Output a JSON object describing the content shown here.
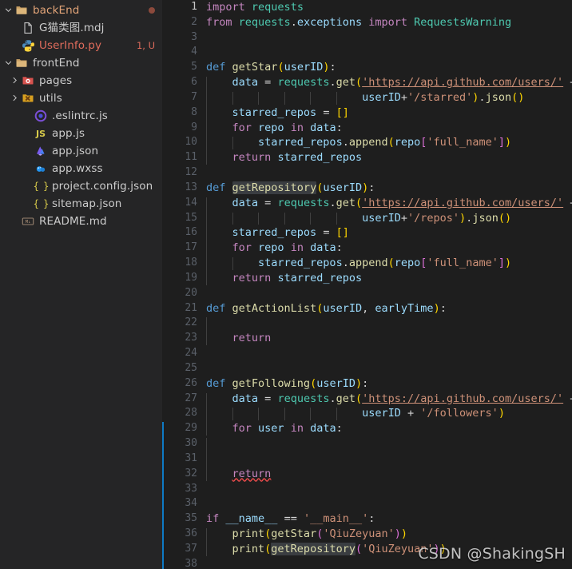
{
  "sidebar": {
    "items": [
      {
        "label": "backEnd",
        "icon": "folder-open-icon",
        "indent": 0,
        "twisty": "chevron-down",
        "state": "modified",
        "badge": "",
        "dot": true
      },
      {
        "label": "G猫类图.mdj",
        "icon": "file-icon",
        "indent": 1,
        "twisty": "",
        "state": "normal",
        "badge": "",
        "dot": false
      },
      {
        "label": "UserInfo.py",
        "icon": "python-icon",
        "indent": 1,
        "twisty": "",
        "state": "untracked",
        "badge": "1, U",
        "dot": false
      },
      {
        "label": "frontEnd",
        "icon": "folder-open-icon",
        "indent": 0,
        "twisty": "chevron-down",
        "state": "normal",
        "badge": "",
        "dot": false
      },
      {
        "label": "pages",
        "icon": "folder-pages-icon",
        "indent": 1,
        "twisty": "chevron-right",
        "state": "normal",
        "badge": "",
        "dot": false
      },
      {
        "label": "utils",
        "icon": "folder-utils-icon",
        "indent": 1,
        "twisty": "chevron-right",
        "state": "normal",
        "badge": "",
        "dot": false
      },
      {
        "label": ".eslintrc.js",
        "icon": "eslint-icon",
        "indent": 2,
        "twisty": "",
        "state": "normal",
        "badge": "",
        "dot": false
      },
      {
        "label": "app.js",
        "icon": "javascript-icon",
        "indent": 2,
        "twisty": "",
        "state": "normal",
        "badge": "",
        "dot": false
      },
      {
        "label": "app.json",
        "icon": "appjson-icon",
        "indent": 2,
        "twisty": "",
        "state": "normal",
        "badge": "",
        "dot": false
      },
      {
        "label": "app.wxss",
        "icon": "wxss-icon",
        "indent": 2,
        "twisty": "",
        "state": "normal",
        "badge": "",
        "dot": false
      },
      {
        "label": "project.config.json",
        "icon": "json-braces-icon",
        "indent": 2,
        "twisty": "",
        "state": "normal",
        "badge": "",
        "dot": false
      },
      {
        "label": "sitemap.json",
        "icon": "json-braces-icon",
        "indent": 2,
        "twisty": "",
        "state": "normal",
        "badge": "",
        "dot": false
      },
      {
        "label": "README.md",
        "icon": "markdown-icon",
        "indent": 1,
        "twisty": "",
        "state": "normal",
        "badge": "",
        "dot": false
      }
    ]
  },
  "editor": {
    "language": "python",
    "active_line": 1,
    "first_line": 1,
    "last_line": 38,
    "selected_word": "getRepository",
    "lines": [
      {
        "n": 1,
        "text": "import requests"
      },
      {
        "n": 2,
        "text": "from requests.exceptions import RequestsWarning"
      },
      {
        "n": 3,
        "text": ""
      },
      {
        "n": 4,
        "text": ""
      },
      {
        "n": 5,
        "text": "def getStar(userID):"
      },
      {
        "n": 6,
        "text": "    data = requests.get('https://api.github.com/users/' +"
      },
      {
        "n": 7,
        "text": "                        userID+'/starred').json()"
      },
      {
        "n": 8,
        "text": "    starred_repos = []"
      },
      {
        "n": 9,
        "text": "    for repo in data:"
      },
      {
        "n": 10,
        "text": "        starred_repos.append(repo['full_name'])"
      },
      {
        "n": 11,
        "text": "    return starred_repos"
      },
      {
        "n": 12,
        "text": ""
      },
      {
        "n": 13,
        "text": "def getRepository(userID):"
      },
      {
        "n": 14,
        "text": "    data = requests.get('https://api.github.com/users/' +"
      },
      {
        "n": 15,
        "text": "                        userID+'/repos').json()"
      },
      {
        "n": 16,
        "text": "    starred_repos = []"
      },
      {
        "n": 17,
        "text": "    for repo in data:"
      },
      {
        "n": 18,
        "text": "        starred_repos.append(repo['full_name'])"
      },
      {
        "n": 19,
        "text": "    return starred_repos"
      },
      {
        "n": 20,
        "text": ""
      },
      {
        "n": 21,
        "text": "def getActionList(userID, earlyTime):"
      },
      {
        "n": 22,
        "text": ""
      },
      {
        "n": 23,
        "text": "    return"
      },
      {
        "n": 24,
        "text": ""
      },
      {
        "n": 25,
        "text": ""
      },
      {
        "n": 26,
        "text": "def getFollowing(userID):"
      },
      {
        "n": 27,
        "text": "    data = requests.get('https://api.github.com/users/' +"
      },
      {
        "n": 28,
        "text": "                        userID + '/followers')"
      },
      {
        "n": 29,
        "text": "    for user in data:"
      },
      {
        "n": 30,
        "text": ""
      },
      {
        "n": 31,
        "text": ""
      },
      {
        "n": 32,
        "text": "    return"
      },
      {
        "n": 33,
        "text": ""
      },
      {
        "n": 34,
        "text": ""
      },
      {
        "n": 35,
        "text": "if __name__ == '__main__':"
      },
      {
        "n": 36,
        "text": "    print(getStar('QiuZeyuan'))"
      },
      {
        "n": 37,
        "text": "    print(getRepository('QiuZeyuan'))"
      },
      {
        "n": 38,
        "text": ""
      }
    ]
  },
  "watermark": {
    "text": "CSDN @ShakingSH"
  },
  "colors": {
    "sidebar_bg": "#252526",
    "editor_bg": "#1e1e1e",
    "accent_blue": "#0e7ac4",
    "modified": "#e2a478",
    "untracked": "#e06c5c",
    "string": "#ce9178",
    "keyword": "#c586c0",
    "function": "#dcdcaa",
    "variable": "#9cdcfe",
    "error_squiggle": "#f14c4c"
  }
}
